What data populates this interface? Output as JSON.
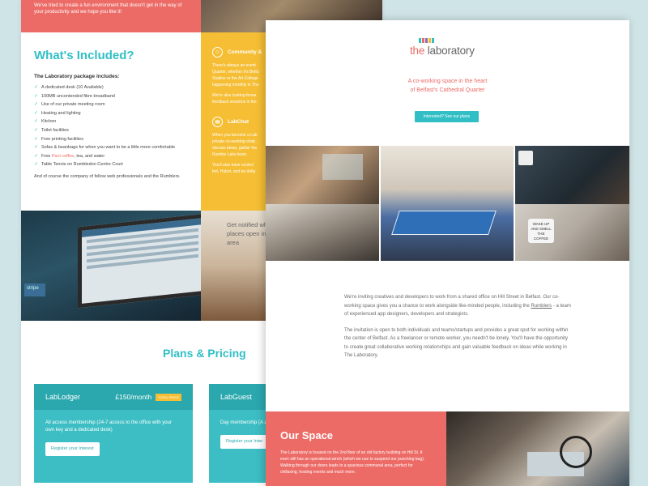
{
  "left": {
    "top_banner_text": "We've tried to create a fun environment that doesn't get in the way of your productivity and we hope you like it!",
    "included": {
      "title": "What's Included?",
      "subtitle": "The Laboratory package includes:",
      "items": [
        "A dedicated desk (10 Available)",
        "100MB uncontended fibre broadband",
        "Use of our private meeting room",
        "Heating and lighting",
        "Kitchen",
        "Toilet facilities",
        "Free printing facilities",
        "Sofas & beanbags for when you want to be a little more comfortable",
        "Free",
        "Table Tennis on Rumbledon Centre Court"
      ],
      "item9_highlight": "Pact coffee",
      "item9_rest": ", tea, and water",
      "footer": "And of course the company of fellow web professionals and the Rumblers."
    },
    "community": {
      "title": "Community &",
      "text1": "There's always an event",
      "text2": "Quarter, whether it's Belfa",
      "text3": "Studios or the Art College",
      "text4": "happening monthly in The",
      "text5": "We're also looking forwa",
      "text6": "feedback sessions in the",
      "chat_title": "LabChat",
      "chat1": "When you become a Lab",
      "chat2": "private co-working chatr...",
      "chat3": "discuss ideas, gather fee",
      "chat4": "Rumble Labs team.",
      "chat5": "You'll also have control",
      "chat6": "bot, Hubot, and be delig"
    },
    "laptop_sticker": "stripe",
    "notify_text": "Get notified when new places open in your area",
    "plans": {
      "title": "Plans & Pricing",
      "card1": {
        "name": "LabLodger",
        "price": "£150/month",
        "badge": "TOTAL PRICE",
        "desc": "All access membership (24-7 access to the office with your own key and a dedicated desk)",
        "button": "Register your Interest"
      },
      "card2": {
        "name": "LabGuest",
        "desc": "Day membership (A available desks, sta processing)",
        "button": "Register your Inter"
      }
    }
  },
  "right": {
    "logo_the": "the ",
    "logo_name": "laboratory",
    "tagline_line1": "A co-working space in the heart",
    "tagline_line2": "of Belfast's Cathedral Quarter",
    "cta": "Interested? See our plans",
    "mug_text": "WAKE UP AND SMELL THE COFFEE",
    "intro_p1_a": "We're inviting creatives and developers to work from a shared office on Hill Street in Belfast. Our co-working space gives you a chance to work alongside like-minded people, including the ",
    "intro_p1_link": "Rumblers",
    "intro_p1_b": " - a team of experienced app designers, developers and strategists.",
    "intro_p2": "The invitation is open to both individuals and teams/startups and provides a great spot for working within the center of Belfast. As a freelancer or remote worker, you needn't be lonely. You'll have the opportunity to create great collaborative working relationships and gain valuable feedback on ideas while working in The Laboratory.",
    "space_title": "Our Space",
    "space_desc": "The Laboratory is housed on the 2nd floor of an old factory building on Hill St. It even still has an operational winch (which we use to suspend our punching bag). Walking through our doors leads to a spacious communal area, perfect for chillaxing, hosting events and much more."
  },
  "colors": {
    "teal": "#31bfc5",
    "coral": "#ec6b66",
    "yellow": "#f5be34",
    "background": "#cfe4e6"
  }
}
